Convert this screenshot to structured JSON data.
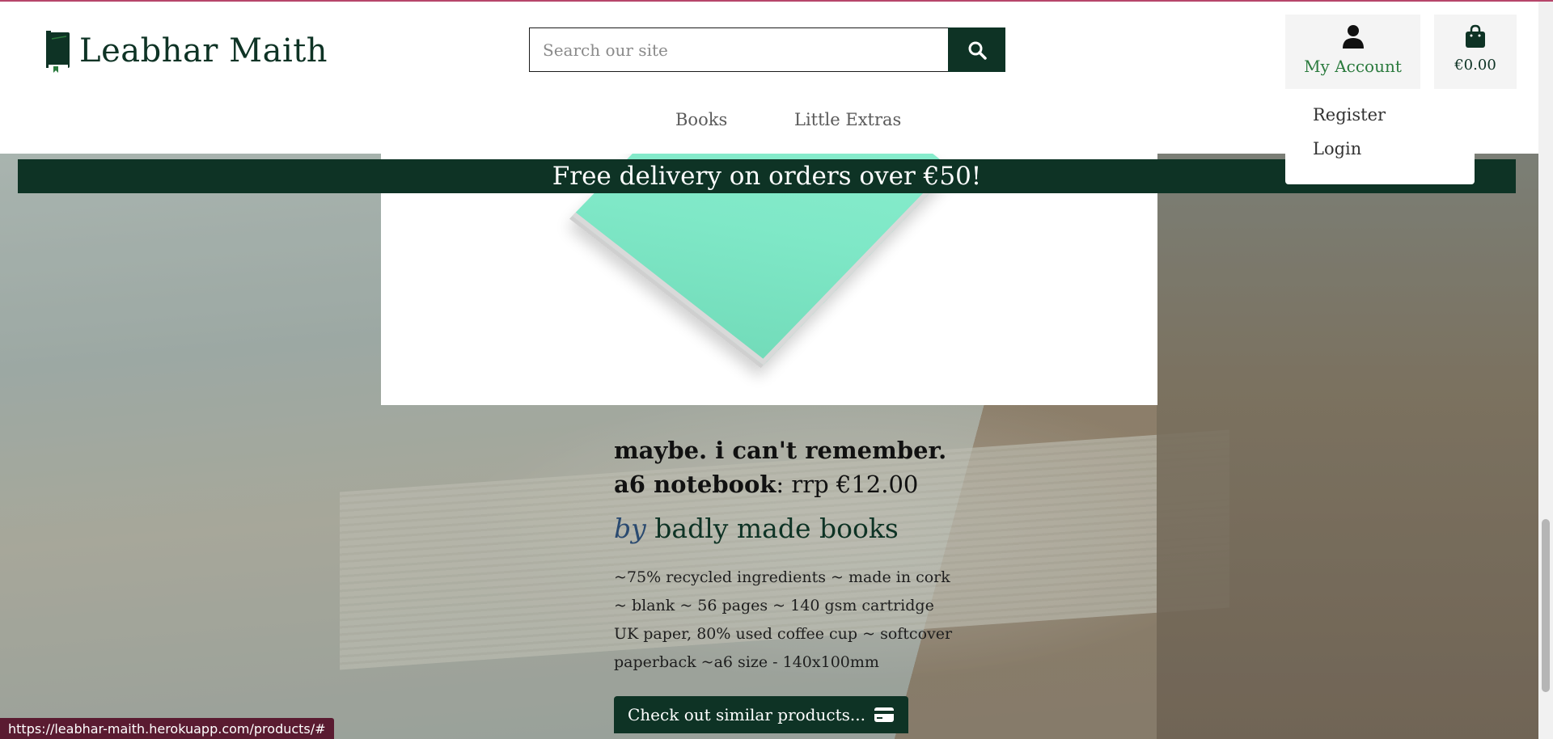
{
  "site": {
    "name": "Leabhar Maith",
    "search_placeholder": "Search our site"
  },
  "header": {
    "account_label": "My Account",
    "bag_total": "€0.00",
    "nav": [
      "Books",
      "Little Extras"
    ]
  },
  "account_menu": [
    "Register",
    "Login"
  ],
  "banner": "Free delivery on orders over €50!",
  "product": {
    "title": "maybe. i can't remember. a6 notebook",
    "price": ": rrp €12.00",
    "by_prefix": "by",
    "author": "badly made books",
    "description": "~75% recycled ingredients ~ made in cork ~ blank ~ 56 pages ~ 140 gsm cartridge UK paper, 80% used coffee cup ~ softcover paperback ~a6 size - 140x100mm",
    "similar_button": "Check out similar products..."
  },
  "status_bar_url": "https://leabhar-maith.herokuapp.com/products/#",
  "colors": {
    "brand": "#0e3325",
    "account_text": "#2a7a3d",
    "status_bar": "#5a1b31"
  }
}
